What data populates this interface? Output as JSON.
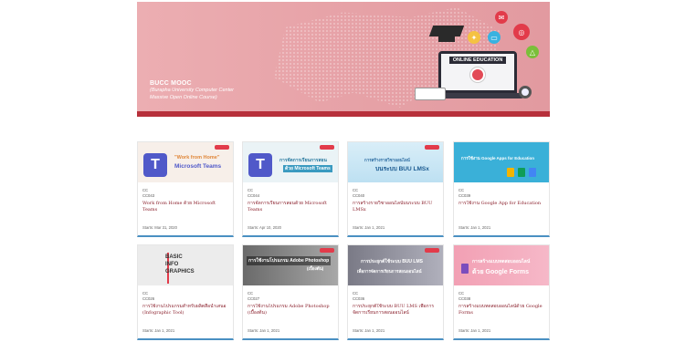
{
  "hero": {
    "title": "BUCC MOOC",
    "subtitle_line1": "(Burapha University Computer Center",
    "subtitle_line2": "Massive Open Online Course)",
    "laptop_label": "ONLINE EDUCATION"
  },
  "courses": [
    {
      "thumb_text": "\"Work from Home\"",
      "thumb_text2": "Microsoft Teams",
      "org": "CC",
      "code": "CC043",
      "title": "Work from Home ด้วย Microsoft Teams",
      "start": "Starts: Mar 31, 2020"
    },
    {
      "thumb_text": "การจัดการเรียนการสอน",
      "thumb_text2": "ด้วย Microsoft Teams",
      "org": "CC",
      "code": "CC044",
      "title": "การจัดการเรียนการสอนด้วย Microsoft Teams",
      "start": "Starts: Apr 10, 2020"
    },
    {
      "thumb_text": "การสร้างรายวิชาออนไลน์",
      "thumb_text2": "บนระบบ BUU LMSx",
      "org": "CC",
      "code": "CC040",
      "title": "การสร้างรายวิชาออนไลน์บนระบบ BUU LMSx",
      "start": "Starts: Jan 1, 2021"
    },
    {
      "thumb_text": "การใช้งาน Google Apps for Education",
      "thumb_text2": "",
      "org": "CC",
      "code": "CC039",
      "title": "การใช้งาน Google App for Education",
      "start": "Starts: Jan 1, 2021"
    },
    {
      "thumb_text": "BASIC",
      "thumb_text2": "INFO",
      "thumb_text3": "GRAPHICS",
      "org": "CC",
      "code": "CC026",
      "title": "การใช้งานโปรแกรมสำหรับผลิตสื่อนำเสนอ (Infographic Tool)",
      "start": "Starts: Jan 1, 2021"
    },
    {
      "thumb_text": "การใช้งานโปรแกรม Adobe Photoshop",
      "thumb_text2": "(เบื้องต้น)",
      "org": "CC",
      "code": "CC027",
      "title": "การใช้งานโปรแกรม Adobe Photoshop (เบื้องต้น)",
      "start": "Starts: Jan 1, 2021"
    },
    {
      "thumb_text": "การประยุกต์ใช้ระบบ BUU LMS",
      "thumb_text2": "เพื่อการจัดการเรียนการสอนออนไลน์",
      "org": "CC",
      "code": "CC036",
      "title": "การประยุกต์ใช้ระบบ BUU LMS เพื่อการจัดการเรียนการสอนออนไลน์",
      "start": "Starts: Jan 1, 2021"
    },
    {
      "thumb_text": "การสร้างแบบทดสอบออนไลน์",
      "thumb_text2": "ด้วย Google Forms",
      "org": "CC",
      "code": "CC038",
      "title": "การสร้างแบบทดสอบออนไลน์ด้วย Google Forms",
      "start": "Starts: Jan 1, 2021"
    }
  ]
}
